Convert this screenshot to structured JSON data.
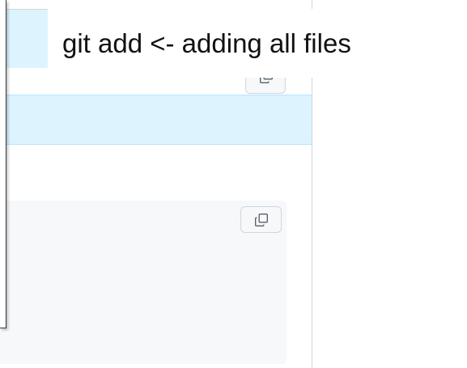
{
  "caption": {
    "text": "git add <- adding all files"
  },
  "buttons": {
    "copy_icon": "copy-icon"
  },
  "colors": {
    "info_background": "#ddf4ff",
    "code_background": "#f6f8fa",
    "border": "#d0d7de"
  }
}
